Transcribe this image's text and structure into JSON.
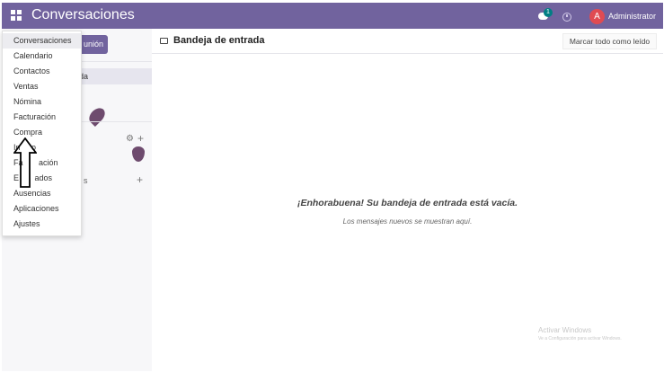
{
  "navbar": {
    "app_title": "Conversaciones",
    "chat_badge": "1",
    "avatar_letter": "A",
    "user_name": "Administrator"
  },
  "sidebar": {
    "meeting_button": "unión",
    "inbox_label": "da",
    "direct_messages_label": "s"
  },
  "main": {
    "title": "Bandeja de entrada",
    "mark_all_read": "Marcar todo como leído",
    "empty_title": "¡Enhorabuena! Su bandeja de entrada está vacía.",
    "empty_subtitle": "Los mensajes nuevos se muestran aquí."
  },
  "apps_menu": {
    "items": [
      "Conversaciones",
      "Calendario",
      "Contactos",
      "Ventas",
      "Nómina",
      "Facturación",
      "Compra",
      "Inventario",
      "Fabricación",
      "Empleados",
      "Ausencias",
      "Aplicaciones",
      "Ajustes"
    ],
    "partial_labels": {
      "inventario": "In     o",
      "fabricacion": "Fa       ación",
      "empleados": "E       ados"
    }
  },
  "watermark": {
    "title": "Activar Windows",
    "subtitle": "Ve a Configuración para activar Windows."
  },
  "colors": {
    "brand": "#71639e",
    "avatar": "#e04b52",
    "badge": "#017e84"
  }
}
